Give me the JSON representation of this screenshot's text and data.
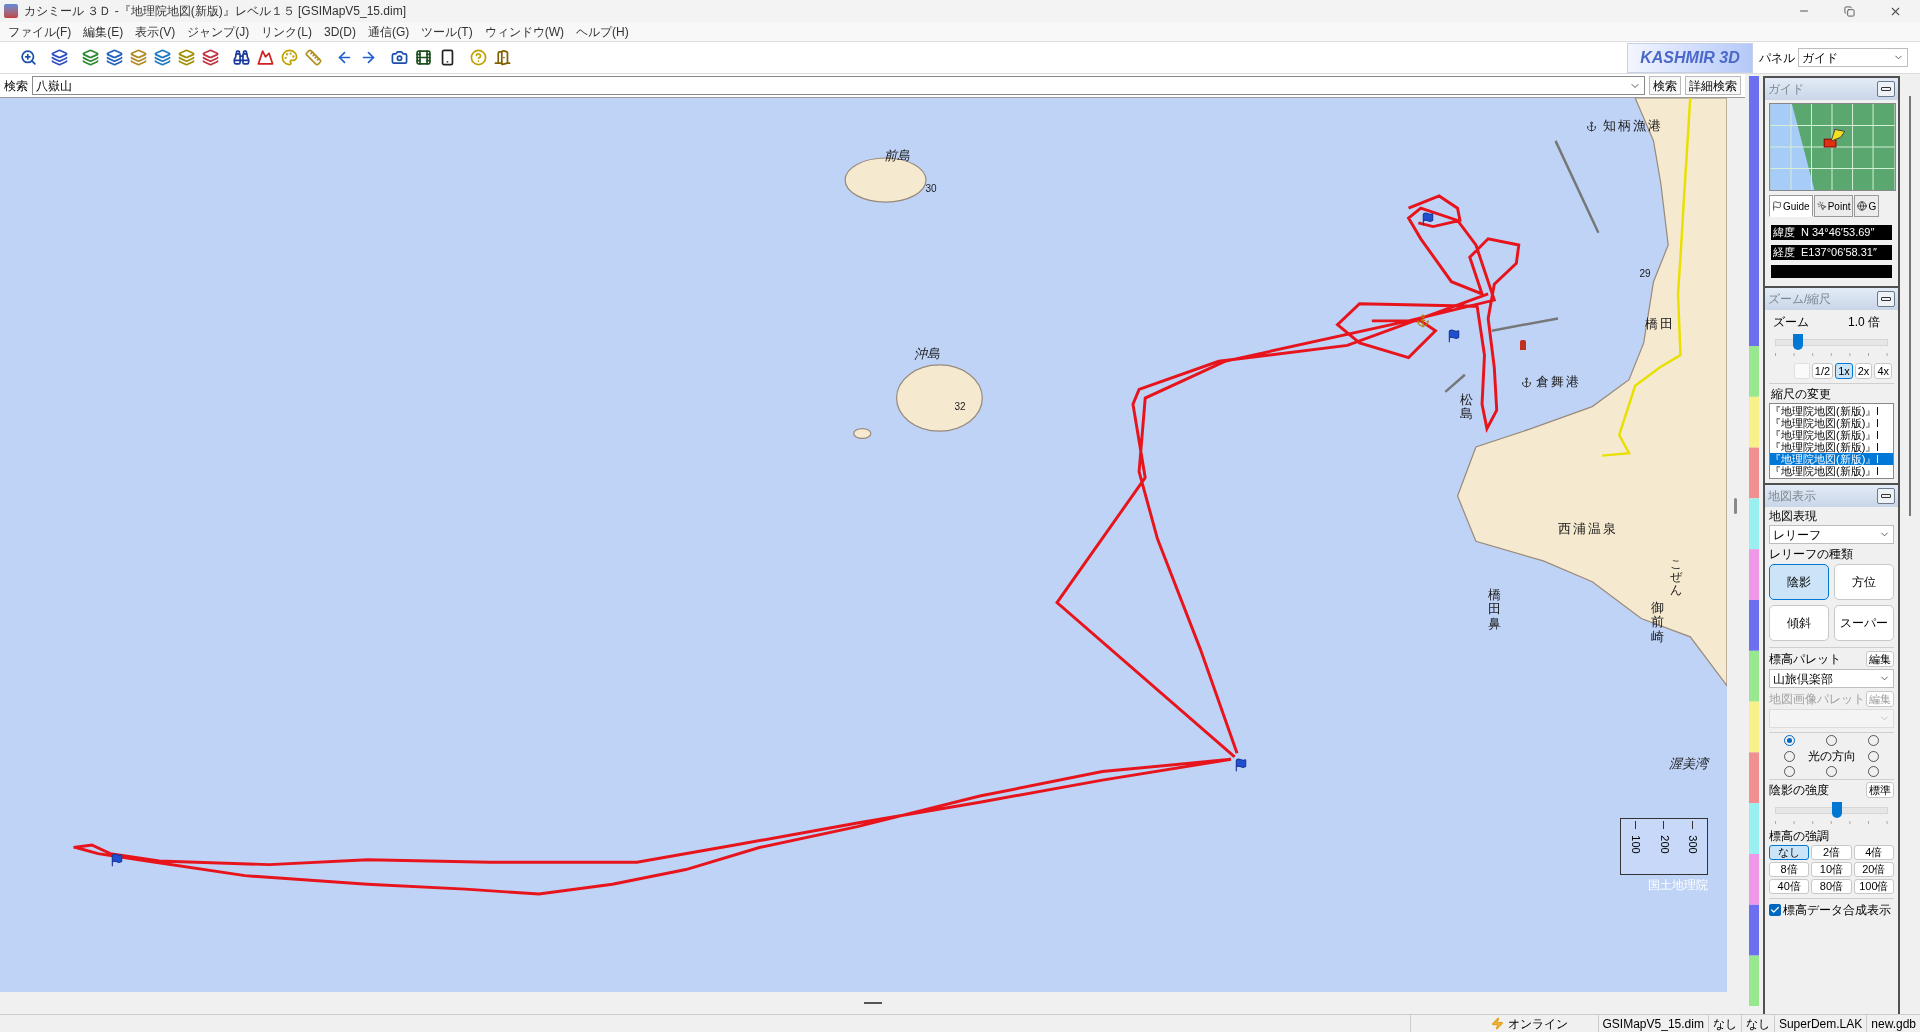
{
  "window": {
    "title": "カシミール ３Ｄ -『地理院地図(新版)』レベル１５ [GSIMapV5_15.dim]"
  },
  "menu": [
    "ファイル(F)",
    "編集(E)",
    "表示(V)",
    "ジャンプ(J)",
    "リンク(L)",
    "3D(D)",
    "通信(G)",
    "ツール(T)",
    "ウィンドウ(W)",
    "ヘルプ(H)"
  ],
  "toolbar": {
    "logo": "KASHMIR 3D",
    "panel_label": "パネル",
    "panel_value": "ガイド"
  },
  "search": {
    "label": "検索",
    "value": "八嶽山",
    "buttons": [
      "検索",
      "詳細検索"
    ]
  },
  "map": {
    "labels": [
      {
        "text": "前島",
        "kind": "island"
      },
      {
        "text": "30",
        "kind": "height"
      },
      {
        "text": "沖島",
        "kind": "island"
      },
      {
        "text": "32",
        "kind": "height"
      },
      {
        "text": "知柄漁港",
        "kind": "port"
      },
      {
        "text": "倉舞港",
        "kind": "port"
      },
      {
        "text": "29",
        "kind": "height"
      },
      {
        "text": "橋田",
        "kind": "town"
      },
      {
        "text": "松島",
        "kind": "vertical"
      },
      {
        "text": "西浦温泉",
        "kind": "town"
      },
      {
        "text": "橋田鼻",
        "kind": "vertical"
      },
      {
        "text": "こぜん",
        "kind": "furigana"
      },
      {
        "text": "御前崎",
        "kind": "vertical"
      },
      {
        "text": "渥美湾",
        "kind": "island"
      }
    ],
    "scale_ticks": [
      "100",
      "200",
      "300"
    ],
    "credit": "国土地理院"
  },
  "guide_panel": {
    "title": "ガイド",
    "tabs": [
      {
        "label": "Guide",
        "selected": true
      },
      {
        "label": "Point",
        "selected": false
      },
      {
        "label": "G",
        "selected": false
      }
    ],
    "coords": [
      {
        "label": "緯度",
        "value": "N 34°46′53.69″"
      },
      {
        "label": "経度",
        "value": "E137°06′58.31″"
      }
    ]
  },
  "zoom_panel": {
    "title": "ズーム/縮尺",
    "label": "ズーム",
    "value": "1.0 倍",
    "level": 0.2,
    "buttons": [
      {
        "label": "1/2",
        "selected": false
      },
      {
        "label": "1x",
        "selected": true
      },
      {
        "label": "2x",
        "selected": false
      },
      {
        "label": "4x",
        "selected": false
      }
    ],
    "scale_title": "縮尺の変更",
    "scale_list": [
      {
        "label": "『地理院地図(新版)』l",
        "selected": false
      },
      {
        "label": "『地理院地図(新版)』l",
        "selected": false
      },
      {
        "label": "『地理院地図(新版)』l",
        "selected": false
      },
      {
        "label": "『地理院地図(新版)』l",
        "selected": false
      },
      {
        "label": "『地理院地図(新版)』l",
        "selected": true
      },
      {
        "label": "『地理院地図(新版)』l",
        "selected": false
      }
    ]
  },
  "display_panel": {
    "title": "地図表示",
    "style_label": "地図表現",
    "style_value": "レリーフ",
    "relief_label": "レリーフの種類",
    "relief_buttons": [
      {
        "label": "陰影",
        "selected": true
      },
      {
        "label": "方位",
        "selected": false
      },
      {
        "label": "傾斜",
        "selected": false
      },
      {
        "label": "スーパー",
        "selected": false
      }
    ],
    "palettes": [
      {
        "label": "標高パレット",
        "edit": "編集",
        "value": "山旅倶楽部",
        "disabled": false
      },
      {
        "label": "地図画像パレット",
        "edit": "編集",
        "disabled": true
      }
    ],
    "light_label": "光の方向",
    "light_options": [
      {
        "selected": true
      },
      {
        "selected": false
      },
      {
        "selected": false
      },
      {
        "selected": false
      },
      {
        "selected": false
      },
      {
        "selected": false
      },
      {
        "selected": false
      },
      {
        "selected": false
      }
    ],
    "shade": {
      "label": "陰影の強度",
      "button": "標準",
      "level": 0.55
    },
    "emphasis_label": "標高の強調",
    "emphasis_buttons": [
      {
        "label": "なし",
        "selected": true
      },
      {
        "label": "2倍",
        "selected": false
      },
      {
        "label": "4倍",
        "selected": false
      },
      {
        "label": "8倍",
        "selected": false
      },
      {
        "label": "10倍",
        "selected": false
      },
      {
        "label": "20倍",
        "selected": false
      },
      {
        "label": "40倍",
        "selected": false
      },
      {
        "label": "80倍",
        "selected": false
      },
      {
        "label": "100倍",
        "selected": false
      }
    ],
    "merge": {
      "label": "標高データ合成表示",
      "checked": true
    }
  },
  "status_bar": [
    {
      "text": "オンライン",
      "kind": "online"
    },
    {
      "text": "GSIMapV5_15.dim",
      "kind": "plain"
    },
    {
      "text": "なし",
      "kind": "plain"
    },
    {
      "text": "なし",
      "kind": "plain"
    },
    {
      "text": "SuperDem.LAK",
      "kind": "plain"
    },
    {
      "text": "new.gdb",
      "kind": "plain"
    }
  ]
}
